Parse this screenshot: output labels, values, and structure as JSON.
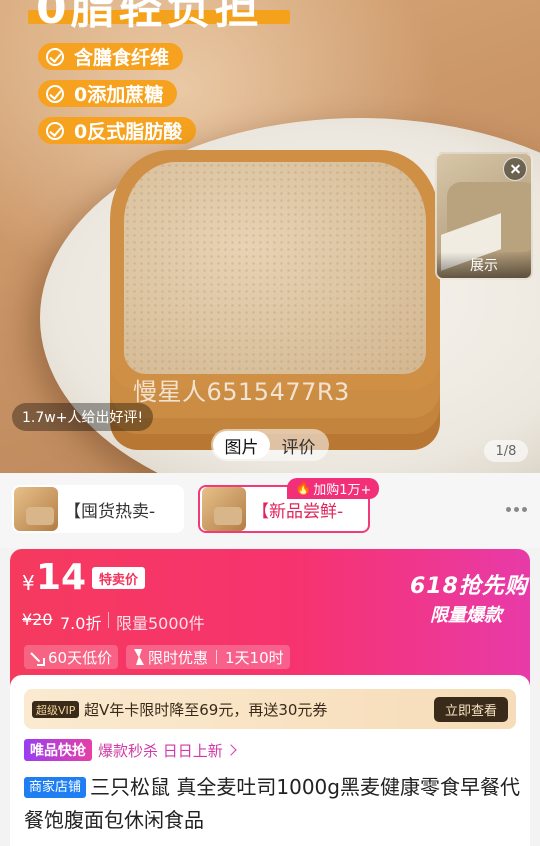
{
  "hero": {
    "headline": "0脂轻负担",
    "features": [
      "含膳食纤维",
      "0添加蔗糖",
      "0反式脂肪酸"
    ],
    "watermark": "慢星人6515477R3",
    "review_pill": "1.7w+人给出好评!",
    "media_tabs": [
      "图片",
      "评价"
    ],
    "counter": "1/8",
    "mini_video_label": "展示"
  },
  "skus": [
    {
      "label": "【囤货热卖-",
      "selected": false
    },
    {
      "label": "【新品尝鲜-",
      "selected": true
    }
  ],
  "sku_badge": "加购1万+",
  "price": {
    "currency": "¥",
    "amount": "14",
    "special_label": "特卖价",
    "original": "¥20",
    "discount": "7.0折",
    "limit": "限量5000件",
    "tags": {
      "low": "60天低价",
      "timed": "限时优惠",
      "countdown": "1天10时"
    },
    "promo_title": "618抢先购",
    "promo_sub": "限量爆款"
  },
  "vip": {
    "badge": "超级VIP",
    "text": "超V年卡限时降至69元，再送30元券",
    "button": "立即查看"
  },
  "flash": {
    "badge": "唯品快抢",
    "text": "爆款秒杀 日日上新"
  },
  "product": {
    "store_badge": "商家店铺",
    "title": "三只松鼠 真全麦吐司1000g黑麦健康零食早餐代餐饱腹面包休闲食品"
  },
  "colors": {
    "accent_pink": "#f2307a",
    "price_banner_start": "#f53a5e",
    "feature_orange": "#f6a21f",
    "store_blue": "#1f7ff2"
  }
}
